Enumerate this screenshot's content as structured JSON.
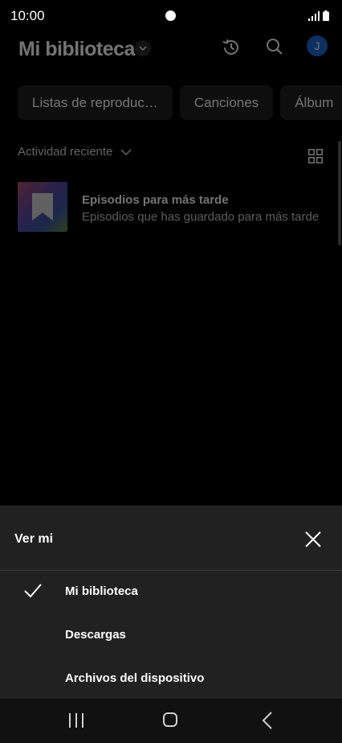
{
  "status": {
    "time": "10:00"
  },
  "header": {
    "title": "Mi biblioteca",
    "avatar_initial": "J"
  },
  "chips": [
    "Listas de reproduc…",
    "Canciones",
    "Álbum"
  ],
  "sort": {
    "label": "Actividad reciente"
  },
  "items": [
    {
      "title": "Episodios para más tarde",
      "subtitle": "Episodios que has guardado para más tarde"
    }
  ],
  "sheet": {
    "title": "Ver mi",
    "options": [
      {
        "label": "Mi biblioteca",
        "selected": true
      },
      {
        "label": "Descargas",
        "selected": false
      },
      {
        "label": "Archivos del dispositivo",
        "selected": false
      }
    ]
  },
  "colors": {
    "accent": "#1f6bd8",
    "background": "#000000",
    "sheet": "#212121"
  },
  "icons": [
    "signal-icon",
    "battery-icon",
    "chevron-down-icon",
    "history-icon",
    "search-icon",
    "grid-view-icon",
    "bookmark-icon",
    "check-icon",
    "close-icon",
    "recent-apps-icon",
    "home-icon",
    "back-icon"
  ]
}
